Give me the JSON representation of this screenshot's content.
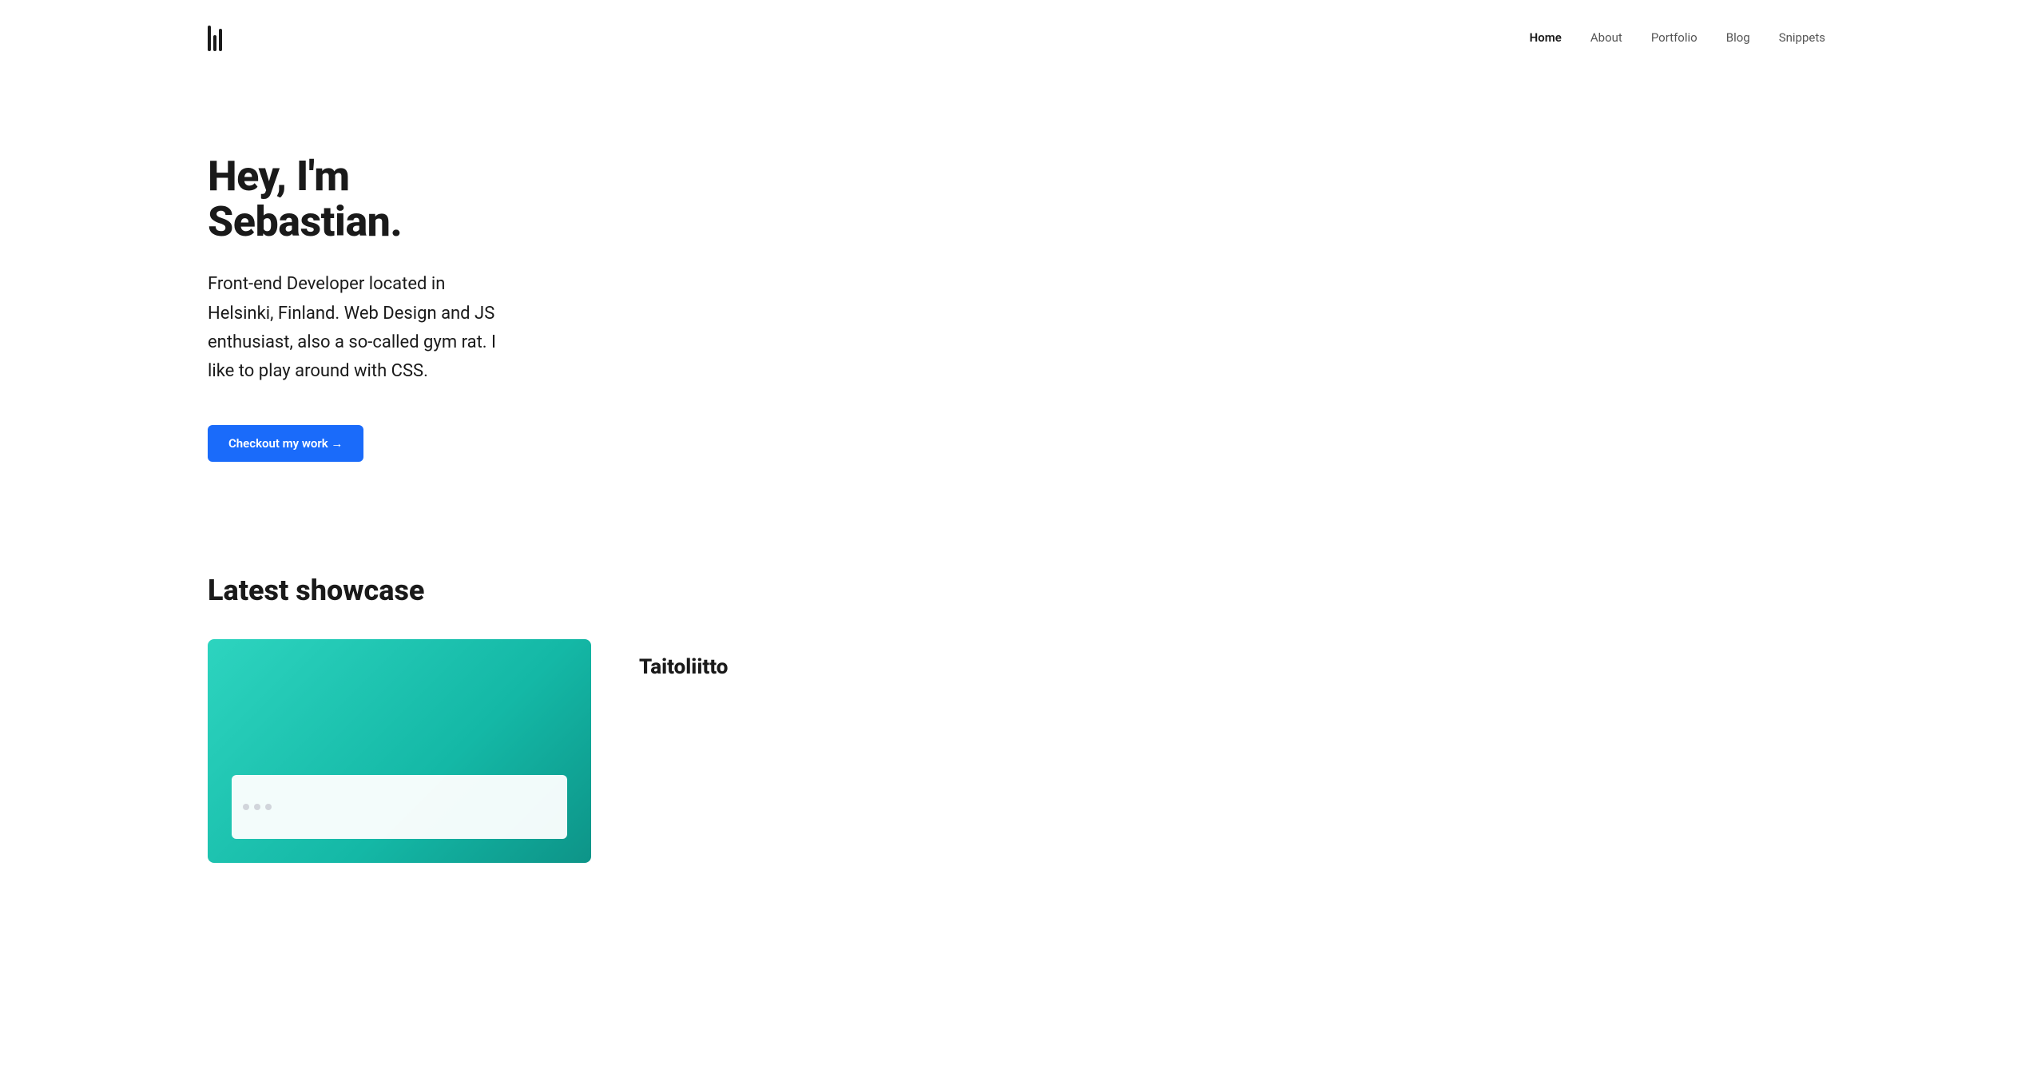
{
  "nav": {
    "logo_alt": "Logo bars icon",
    "links": [
      {
        "label": "Home",
        "active": true
      },
      {
        "label": "About",
        "active": false
      },
      {
        "label": "Portfolio",
        "active": false
      },
      {
        "label": "Blog",
        "active": false
      },
      {
        "label": "Snippets",
        "active": false
      }
    ]
  },
  "hero": {
    "heading": "Hey, I'm Sebastian.",
    "description": "Front-end Developer located in Helsinki, Finland. Web Design and JS enthusiast, also a so-called gym rat. I like to play around with CSS.",
    "cta_label": "Checkout my work →"
  },
  "showcase": {
    "heading": "Latest showcase",
    "card": {
      "title": "Taitoliitto"
    }
  }
}
